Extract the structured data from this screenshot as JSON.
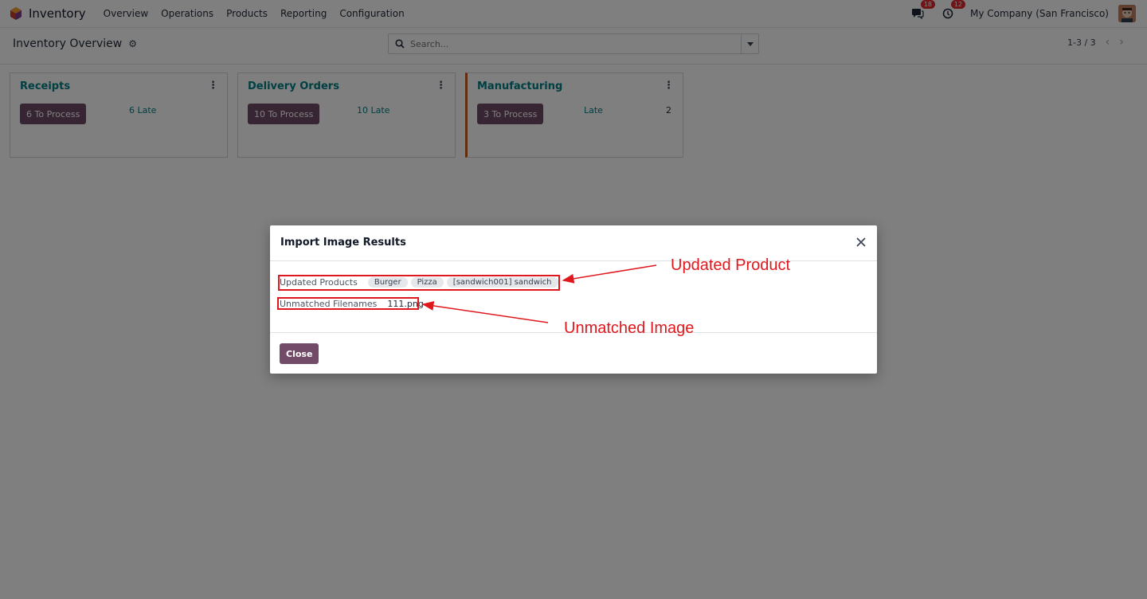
{
  "navbar": {
    "app_name": "Inventory",
    "menu": [
      "Overview",
      "Operations",
      "Products",
      "Reporting",
      "Configuration"
    ],
    "messages_badge": "18",
    "activities_badge": "12",
    "company": "My Company (San Francisco)"
  },
  "control": {
    "title": "Inventory Overview",
    "search_placeholder": "Search...",
    "pager": "1-3 / 3"
  },
  "cards": [
    {
      "title": "Receipts",
      "process": "6 To Process",
      "late": "6 Late",
      "late_count": ""
    },
    {
      "title": "Delivery Orders",
      "process": "10 To Process",
      "late": "10 Late",
      "late_count": ""
    },
    {
      "title": "Manufacturing",
      "process": "3 To Process",
      "late": "Late",
      "late_count": "2"
    }
  ],
  "modal": {
    "title": "Import Image Results",
    "updated_label": "Updated Products",
    "updated_tags": [
      "Burger",
      "Pizza",
      "[sandwich001] sandwich"
    ],
    "unmatched_label": "Unmatched Filenames",
    "unmatched_value": "111.png",
    "close_label": "Close"
  },
  "annotations": {
    "updated": "Updated Product",
    "unmatched": "Unmatched Image",
    "color": "#e0181d"
  },
  "colors": {
    "primary": "#714b67",
    "link": "#017e84"
  }
}
